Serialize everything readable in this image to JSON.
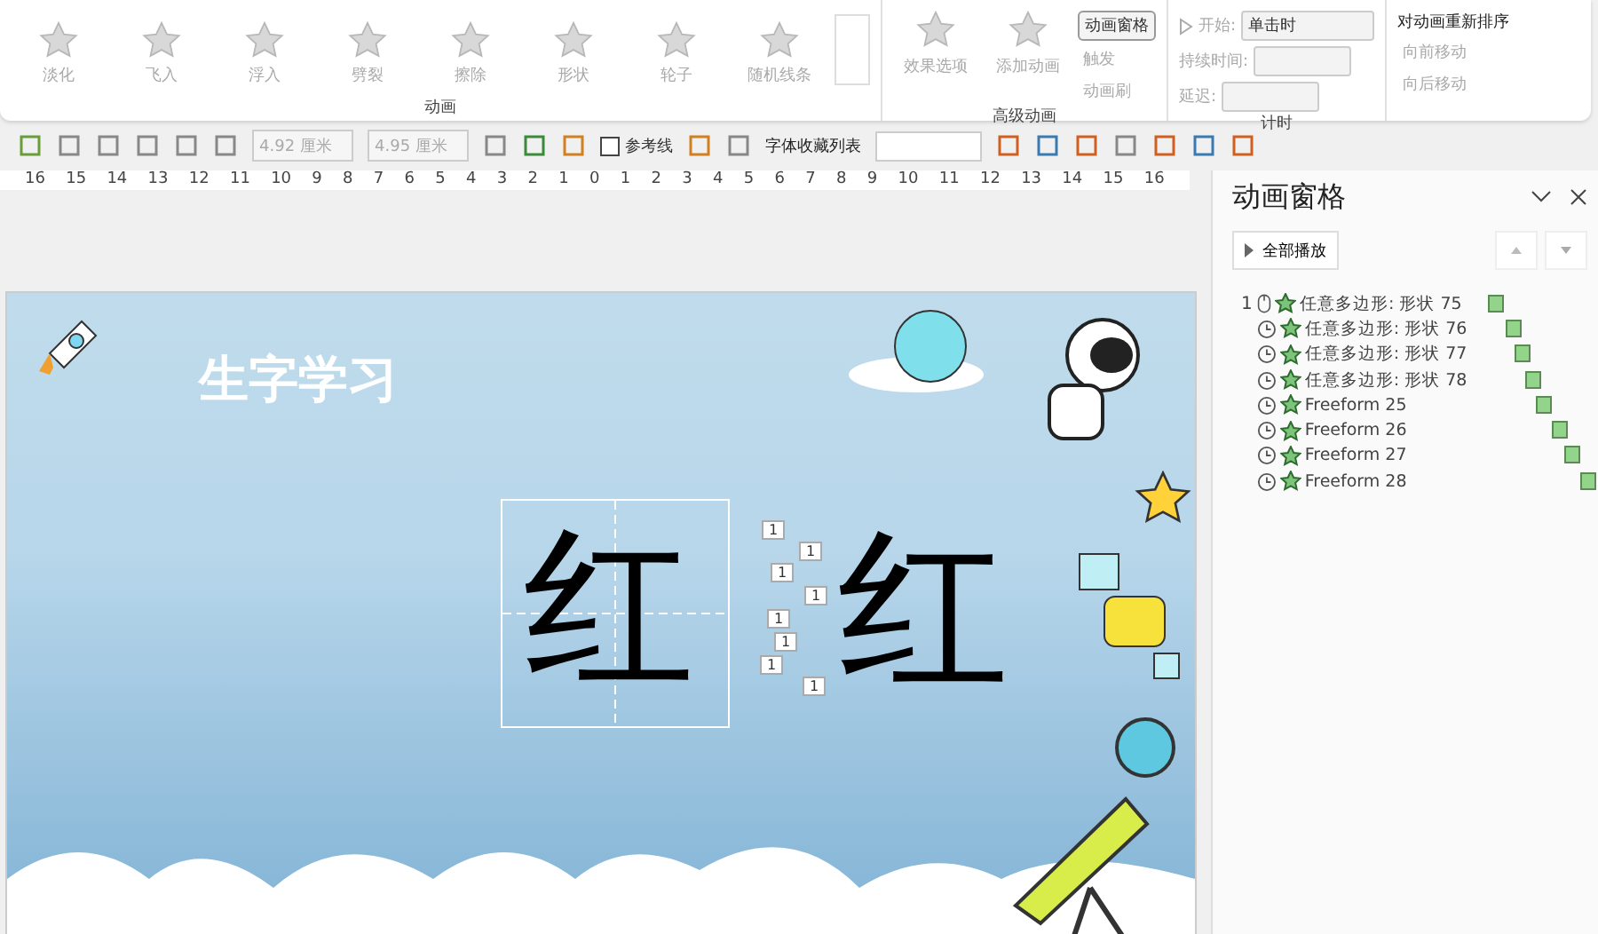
{
  "ribbon": {
    "effects": [
      {
        "label": "淡化"
      },
      {
        "label": "飞入"
      },
      {
        "label": "浮入"
      },
      {
        "label": "劈裂"
      },
      {
        "label": "擦除"
      },
      {
        "label": "形状"
      },
      {
        "label": "轮子"
      },
      {
        "label": "随机线条"
      }
    ],
    "animation_group": "动画",
    "effect_options": "效果选项",
    "add_animation": "添加动画",
    "animation_pane": {
      "label": "动画窗格",
      "selected": true
    },
    "trigger": "触发",
    "painter": "动画刷",
    "advanced_group": "高级动画",
    "start": {
      "label": "开始:",
      "value": "单击时"
    },
    "duration": {
      "label": "持续时间:"
    },
    "delay": {
      "label": "延迟:"
    },
    "timing_group": "计时",
    "reorder": {
      "title": "对动画重新排序",
      "forward": "向前移动",
      "backward": "向后移动"
    }
  },
  "toolbar": {
    "width": "4.92 厘米",
    "height": "4.95 厘米",
    "guides": {
      "label": "参考线",
      "checked": false
    },
    "font_favorites": "字体收藏列表"
  },
  "ruler": [
    "16",
    "15",
    "14",
    "13",
    "12",
    "11",
    "10",
    "9",
    "8",
    "7",
    "6",
    "5",
    "4",
    "3",
    "2",
    "1",
    "0",
    "1",
    "2",
    "3",
    "4",
    "5",
    "6",
    "7",
    "8",
    "9",
    "10",
    "11",
    "12",
    "13",
    "14",
    "15",
    "16"
  ],
  "slide": {
    "title": "生字学习",
    "characters": [
      "红",
      "红"
    ],
    "tags": [
      "1",
      "1",
      "1",
      "1",
      "1",
      "1",
      "1",
      "1"
    ]
  },
  "pane": {
    "title": "动画窗格",
    "play_all": "全部播放",
    "items": [
      {
        "order": "1",
        "kind": "click",
        "name": "任意多边形: 形状 75"
      },
      {
        "kind": "after",
        "name": "任意多边形: 形状 76"
      },
      {
        "kind": "after",
        "name": "任意多边形: 形状 77"
      },
      {
        "kind": "after",
        "name": "任意多边形: 形状 78"
      },
      {
        "kind": "after",
        "name": "Freeform 25"
      },
      {
        "kind": "after",
        "name": "Freeform 26"
      },
      {
        "kind": "after",
        "name": "Freeform 27"
      },
      {
        "kind": "after",
        "name": "Freeform 28"
      }
    ]
  }
}
